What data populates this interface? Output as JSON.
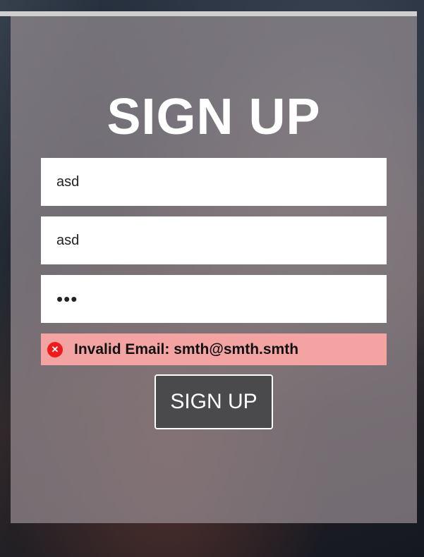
{
  "form": {
    "title": "SIGN UP",
    "fields": [
      {
        "value": "asd"
      },
      {
        "value": "asd"
      },
      {
        "value": "•••"
      }
    ],
    "error": {
      "message": "Invalid Email: smth@smth.smth",
      "icon": "error-circle-icon",
      "color": "#f01c1c",
      "background": "#f4a3a3"
    },
    "submit_label": "SIGN UP"
  }
}
